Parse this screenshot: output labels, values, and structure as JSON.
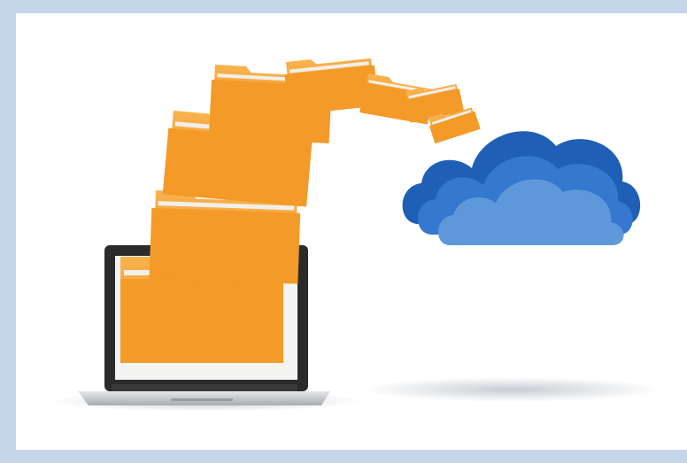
{
  "image": {
    "frame_color": "#c5d5ea",
    "canvas_color": "#ffffff",
    "colors": {
      "folder": "#f49d2a",
      "folder_light": "#f7b24a",
      "folder_dark": "#d9801a",
      "paper": "#f1efe9",
      "cloud_dark": "#1f5fb5",
      "cloud_mid": "#3478cf",
      "cloud_light": "#5f98da",
      "laptop_frame": "#2a2a2a",
      "laptop_base": "#c9cbcd"
    },
    "icons": [
      "laptop-icon",
      "folder-icon",
      "cloud-icon"
    ]
  }
}
